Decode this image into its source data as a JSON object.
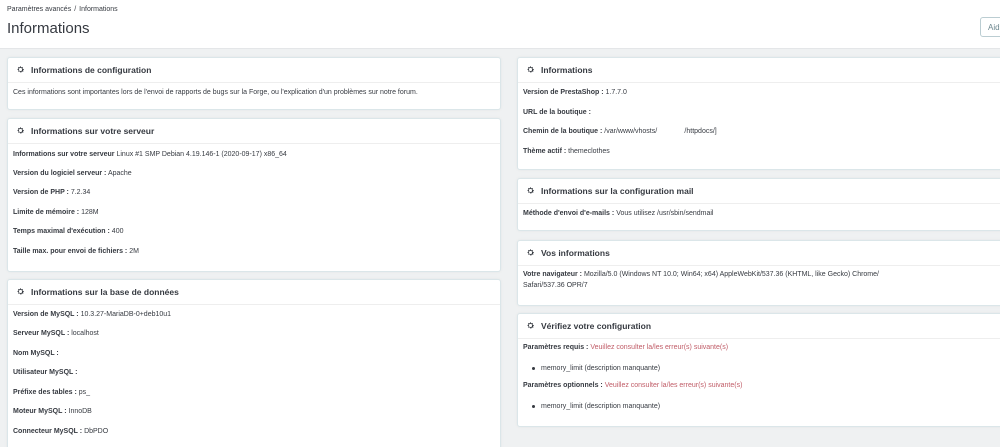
{
  "breadcrumb": {
    "parent": "Paramètres avancés",
    "separator": "/",
    "current": "Informations"
  },
  "page_title": "Informations",
  "help_button": "Aide",
  "config_panel": {
    "title": "Informations de configuration",
    "text": "Ces informations sont importantes lors de l'envoi de rapports de bugs sur la Forge, ou l'explication d'un problèmes sur notre forum."
  },
  "server_panel": {
    "title": "Informations sur votre serveur",
    "rows": [
      {
        "label": "Informations sur votre serveur",
        "value": "Linux #1 SMP Debian 4.19.146-1 (2020-09-17) x86_64"
      },
      {
        "label": "Version du logiciel serveur :",
        "value": "Apache"
      },
      {
        "label": "Version de PHP :",
        "value": "7.2.34"
      },
      {
        "label": "Limite de mémoire :",
        "value": "128M"
      },
      {
        "label": "Temps maximal d'exécution :",
        "value": "400"
      },
      {
        "label": "Taille max. pour envoi de fichiers :",
        "value": "2M"
      }
    ]
  },
  "db_panel": {
    "title": "Informations sur la base de données",
    "rows": [
      {
        "label": "Version de MySQL :",
        "value": "10.3.27-MariaDB-0+deb10u1"
      },
      {
        "label": "Serveur MySQL :",
        "value": "localhost"
      },
      {
        "label": "Nom MySQL :",
        "value": ""
      },
      {
        "label": "Utilisateur MySQL :",
        "value": ""
      },
      {
        "label": "Préfixe des tables :",
        "value": "ps_"
      },
      {
        "label": "Moteur MySQL :",
        "value": "InnoDB"
      },
      {
        "label": "Connecteur MySQL :",
        "value": "DbPDO"
      }
    ]
  },
  "info_panel": {
    "title": "Informations",
    "rows": [
      {
        "label": "Version de PrestaShop :",
        "value": "1.7.7.0"
      },
      {
        "label": "URL de la boutique :",
        "value": ""
      },
      {
        "label": "Chemin de la boutique :",
        "value": "/var/www/vhosts/              /httpdocs/]"
      },
      {
        "label": "Thème actif :",
        "value": "themeclothes"
      }
    ]
  },
  "mail_panel": {
    "title": "Informations sur la configuration mail",
    "label": "Méthode d'envoi d'e-mails :",
    "value": "Vous utilisez /usr/sbin/sendmail"
  },
  "you_panel": {
    "title": "Vos informations",
    "label": "Votre navigateur :",
    "value_line1": "Mozilla/5.0 (Windows NT 10.0; Win64; x64) AppleWebKit/537.36 (KHTML, like Gecko) Chrome/",
    "value_line2": "Safari/537.36 OPR/7"
  },
  "check_panel": {
    "title": "Vérifiez votre configuration",
    "required_label": "Paramètres requis :",
    "required_link": "Veuillez consulter la/les erreur(s) suivante(s)",
    "required_item": "memory_limit (description manquante)",
    "optional_label": "Paramètres optionnels :",
    "optional_link": "Veuillez consulter la/les erreur(s) suivante(s)",
    "optional_item": "memory_limit (description manquante)"
  },
  "colors": {
    "link": "#c05c67",
    "text": "#363a41",
    "background": "#eff1f2",
    "border": "#dbe6e9"
  },
  "icons": {
    "panel_heading": "gear-icon"
  }
}
